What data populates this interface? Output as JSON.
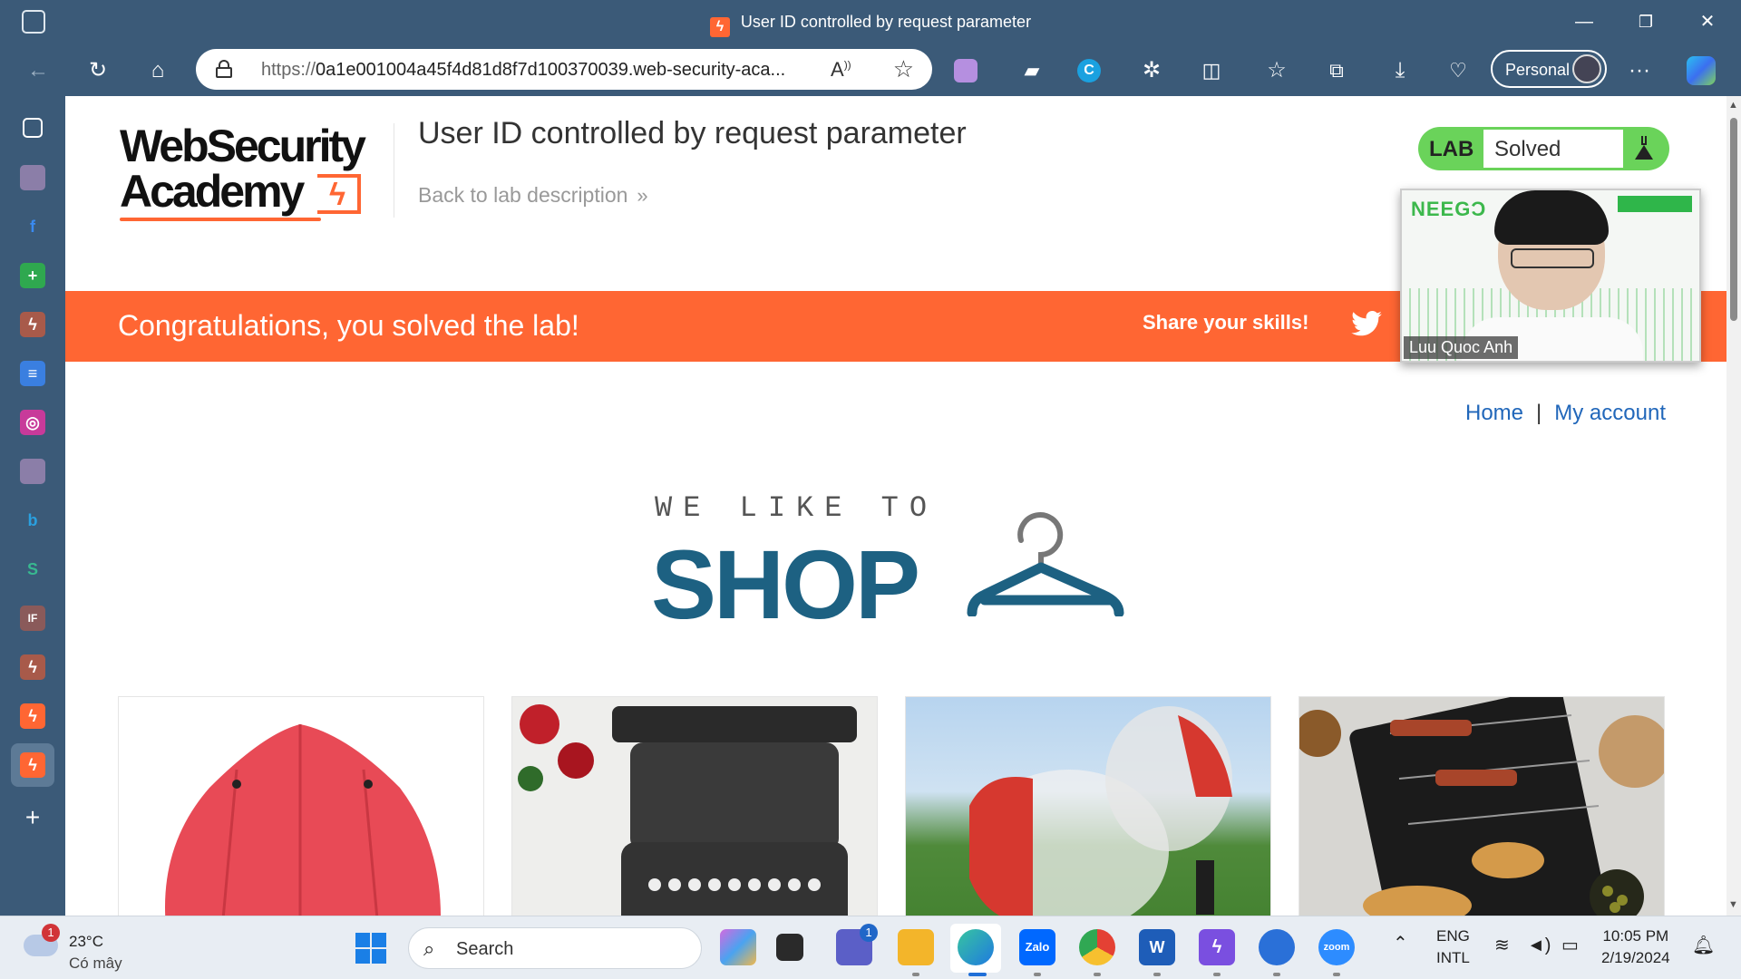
{
  "window": {
    "title": "User ID controlled by request parameter",
    "minimize_glyph": "—",
    "restore_glyph": "❐",
    "close_glyph": "✕"
  },
  "browser": {
    "url_prefix": "https://",
    "url_main": "0a1e001004a45f4d81d8f7d100370039.web-security-aca...",
    "profile_label": "Personal",
    "read_aloud_glyph": "Á",
    "more_glyph": "···"
  },
  "sidebar": {
    "icons": [
      "tabs-icon",
      "book-icon",
      "facebook-icon",
      "sheets-icon",
      "burp-icon",
      "docs-icon",
      "instagram-icon",
      "book-icon-2",
      "bing-icon",
      "s-icon",
      "if-icon",
      "burp-icon-2",
      "burp-icon-3",
      "burp-icon-active"
    ],
    "add_glyph": "+"
  },
  "page": {
    "logo_line1": "WebSecurity",
    "logo_line2": "Academy",
    "lab_title": "User ID controlled by request parameter",
    "back_link": "Back to lab description",
    "back_chevron": "»",
    "lab_badge_label": "LAB",
    "lab_status": "Solved",
    "banner_message": "Congratulations, you solved the lab!",
    "share_label": "Share your skills!",
    "nav": {
      "home": "Home",
      "separator": "|",
      "account": "My account"
    },
    "shop_tagline": "WE LIKE TO",
    "shop_word": "SHOP"
  },
  "webcam": {
    "participant_name": "Luu Quoc Anh",
    "bg_logo": "NEEGƆ"
  },
  "products": [
    {
      "image": "red-umbrella"
    },
    {
      "image": "vintage-typewriter"
    },
    {
      "image": "inflatable-bubble-suit"
    },
    {
      "image": "portable-grill"
    }
  ],
  "taskbar": {
    "weather_temp": "23°C",
    "weather_cond": "Có mây",
    "weather_badge": "1",
    "search_label": "Search",
    "teams_badge": "1",
    "lang_line1": "ENG",
    "lang_line2": "INTL",
    "time": "10:05 PM",
    "date": "2/19/2024",
    "zalo_label": "Zalo",
    "zoom_label": "zoom",
    "word_label": "W"
  },
  "colors": {
    "accent_orange": "#ff6633",
    "lab_green": "#6ad35a",
    "link_blue": "#2167ba",
    "shop_blue": "#1d6182",
    "browser_chrome": "#3b5a78"
  }
}
